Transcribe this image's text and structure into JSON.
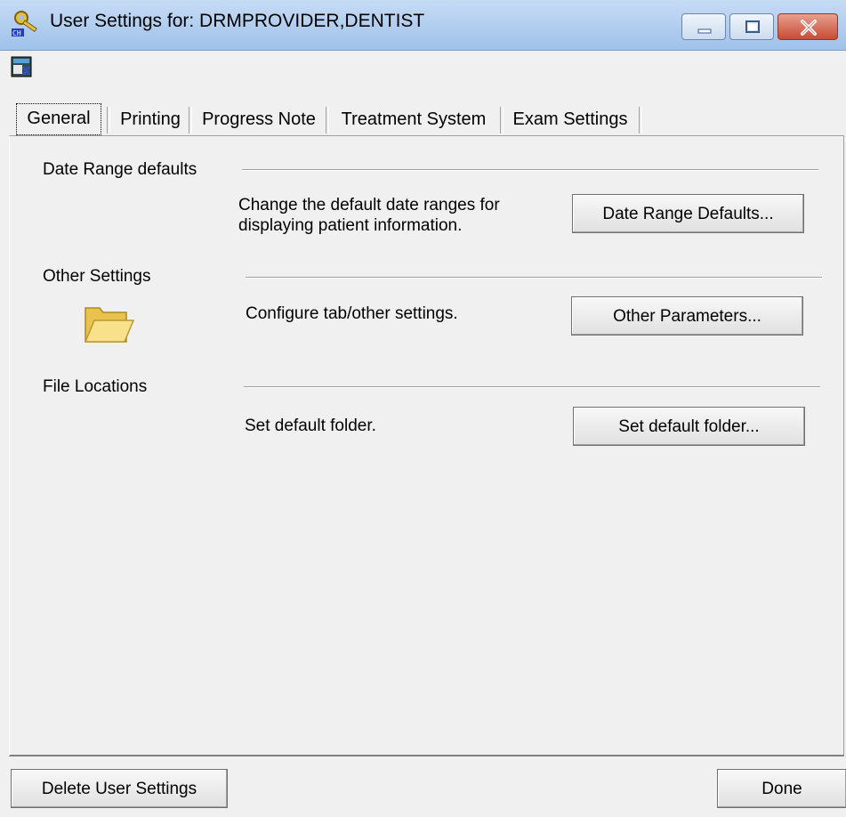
{
  "window": {
    "title": "User Settings for: DRMPROVIDER,DENTIST",
    "controls": [
      "minimize-icon",
      "maximize-icon",
      "close-icon"
    ]
  },
  "toolbar": {
    "icons": [
      "report-icon"
    ]
  },
  "tabs": [
    {
      "label": "General",
      "active": true
    },
    {
      "label": "Printing",
      "active": false
    },
    {
      "label": "Progress Note",
      "active": false
    },
    {
      "label": "Treatment System",
      "active": false
    },
    {
      "label": "Exam Settings",
      "active": false
    }
  ],
  "sections": {
    "date_range": {
      "heading": "Date Range defaults",
      "description_line1": "Change the default date ranges for",
      "description_line2": "displaying patient information.",
      "button_label": "Date Range Defaults..."
    },
    "other": {
      "heading": "Other Settings",
      "description": "Configure tab/other settings.",
      "button_label": "Other Parameters...",
      "icon": "folder-icon"
    },
    "file_locations": {
      "heading": "File Locations",
      "description": "Set default folder.",
      "button_label": "Set default folder..."
    }
  },
  "footer": {
    "delete_label": "Delete User Settings",
    "done_label": "Done"
  },
  "colors": {
    "titlebar_start": "#c6dcf5",
    "titlebar_end": "#9fc1ea",
    "close_red": "#c74b34",
    "folder_yellow": "#f5d76e"
  }
}
